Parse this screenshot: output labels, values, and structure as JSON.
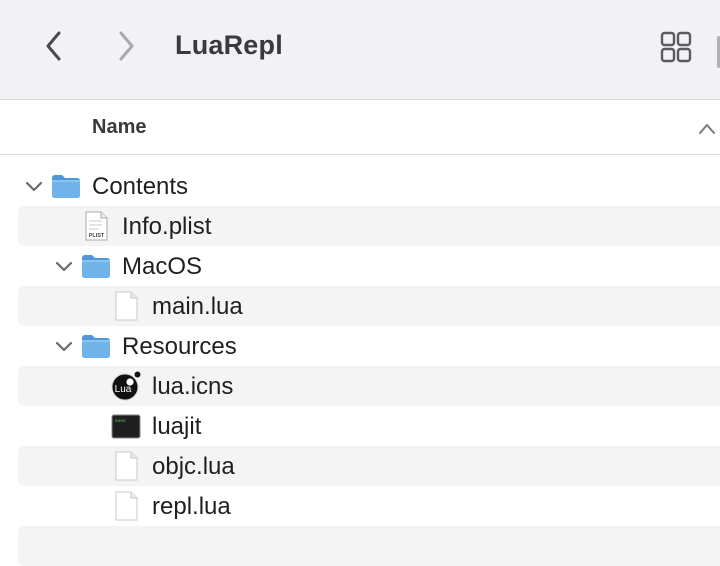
{
  "window": {
    "title": "LuaRepl"
  },
  "toolbar": {
    "back_icon": "chevron-left-icon",
    "forward_icon": "chevron-right-icon",
    "view_icon": "grid-view-icon"
  },
  "columns": {
    "name": "Name",
    "sort": "ascending"
  },
  "files": [
    {
      "label": "Contents",
      "type": "folder",
      "expanded": true,
      "depth": 0
    },
    {
      "label": "Info.plist",
      "type": "plist",
      "depth": 1,
      "icon_text": "PLIST"
    },
    {
      "label": "MacOS",
      "type": "folder",
      "expanded": true,
      "depth": 1
    },
    {
      "label": "main.lua",
      "type": "document",
      "depth": 2
    },
    {
      "label": "Resources",
      "type": "folder",
      "expanded": true,
      "depth": 1
    },
    {
      "label": "lua.icns",
      "type": "icns",
      "depth": 2,
      "icon_text": "Lua"
    },
    {
      "label": "luajit",
      "type": "executable",
      "depth": 2,
      "icon_text": "exec"
    },
    {
      "label": "objc.lua",
      "type": "document",
      "depth": 2
    },
    {
      "label": "repl.lua",
      "type": "document",
      "depth": 2
    }
  ],
  "colors": {
    "folder": "#6fb3ea",
    "folder_tab": "#4f97d8",
    "toolbar_bg": "#f2f2f5",
    "alt_row": "#f4f4f5"
  }
}
